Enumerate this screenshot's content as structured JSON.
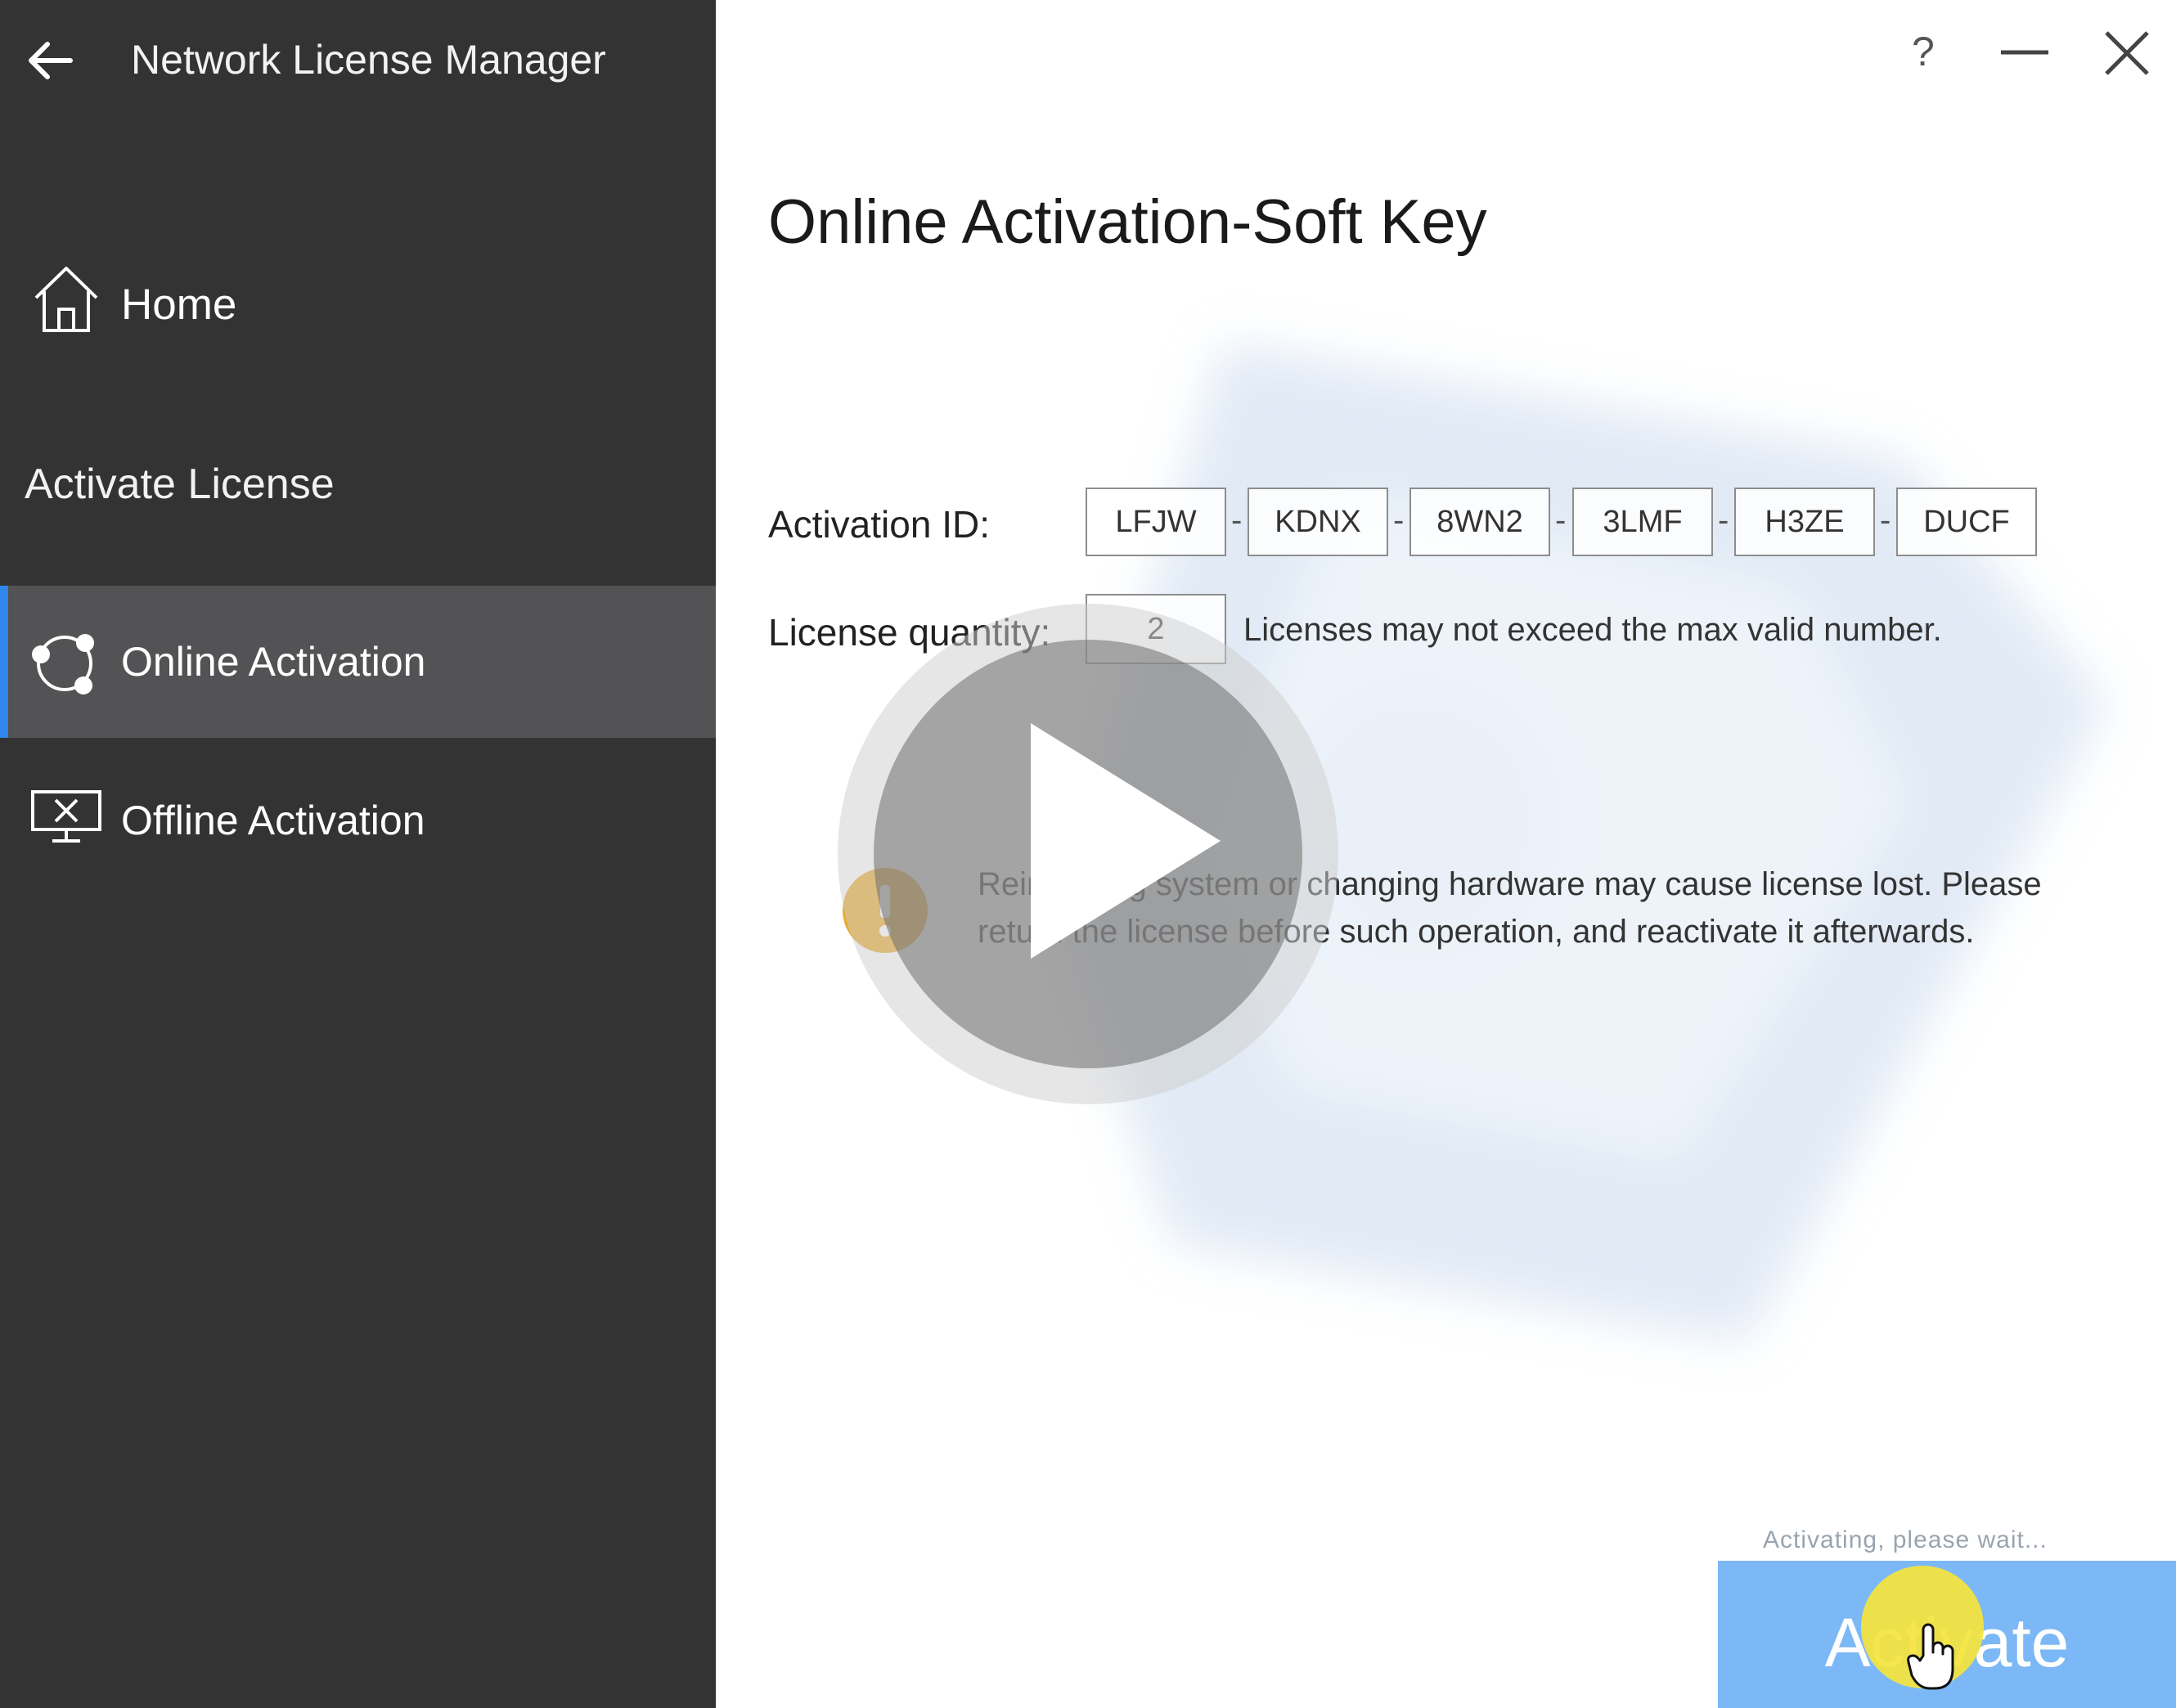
{
  "sidebar": {
    "title": "Network License Manager",
    "home_label": "Home",
    "section_label": "Activate License",
    "online_label": "Online Activation",
    "offline_label": "Offline Activation"
  },
  "window": {
    "help_label": "?"
  },
  "main": {
    "title": "Online Activation-Soft Key",
    "activation_id_label": "Activation ID:",
    "activation_id_parts": [
      "LFJW",
      "KDNX",
      "8WN2",
      "3LMF",
      "H3ZE",
      "DUCF"
    ],
    "separator": "-",
    "quantity_label": "License quantity:",
    "quantity_value": "2",
    "quantity_note": "Licenses may not exceed the max valid number.",
    "warning_line1": "Reinstalling system or changing hardware may cause license lost. Please",
    "warning_line2": "return the license before such operation, and reactivate it afterwards.",
    "status_text": "Activating, please wait...",
    "activate_label": "Activate"
  },
  "colors": {
    "sidebar_bg": "#333334",
    "selected_bg": "#535355",
    "accent": "#2f86ec",
    "button_bg": "#7cb8f6",
    "warning": "#e6a21b"
  }
}
